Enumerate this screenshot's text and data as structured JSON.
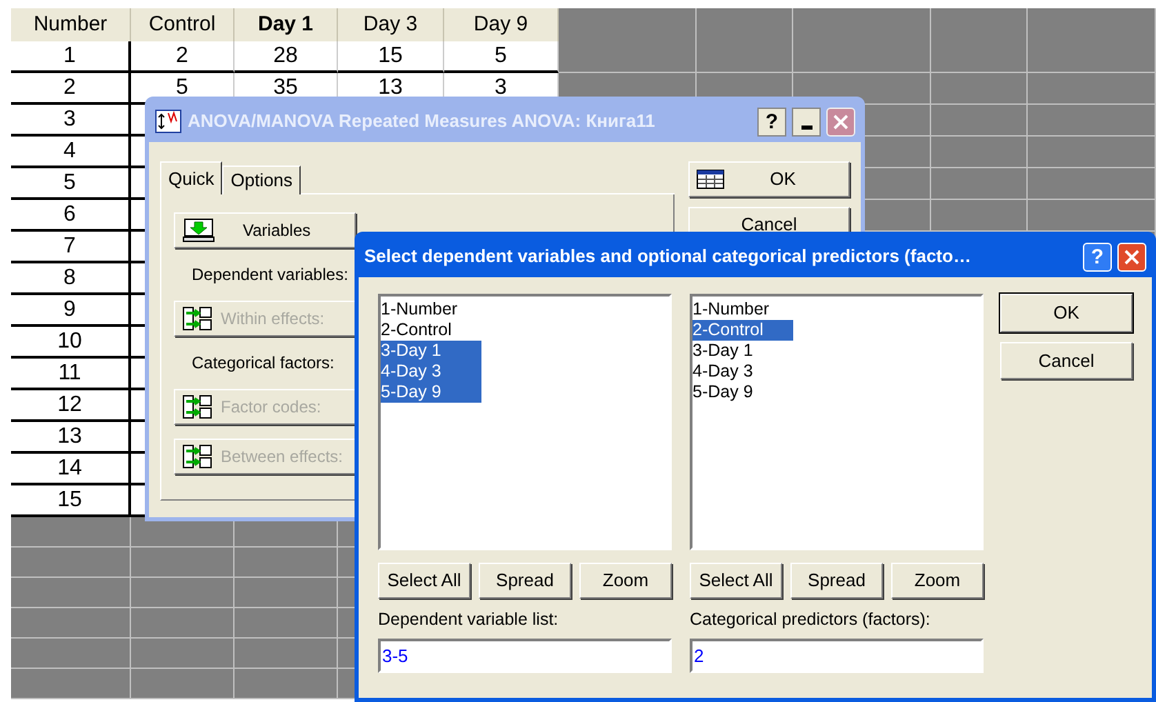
{
  "spreadsheet": {
    "columns": [
      {
        "label": "Number",
        "bold": false
      },
      {
        "label": "Control",
        "bold": false
      },
      {
        "label": "Day 1",
        "bold": true
      },
      {
        "label": "Day 3",
        "bold": false
      },
      {
        "label": "Day 9",
        "bold": false
      }
    ],
    "rows": [
      [
        "1",
        "2",
        "28",
        "15",
        "5"
      ],
      [
        "2",
        "5",
        "35",
        "13",
        "3"
      ],
      [
        "3"
      ],
      [
        "4"
      ],
      [
        "5"
      ],
      [
        "6"
      ],
      [
        "7"
      ],
      [
        "8"
      ],
      [
        "9"
      ],
      [
        "10"
      ],
      [
        "11"
      ],
      [
        "12"
      ],
      [
        "13"
      ],
      [
        "14"
      ],
      [
        "15"
      ]
    ]
  },
  "main_dialog": {
    "title": "ANOVA/MANOVA Repeated Measures ANOVA: Книга11",
    "active": false,
    "help": "?",
    "tabs": [
      {
        "label": "Quick",
        "selected": true
      },
      {
        "label": "Options",
        "selected": false
      }
    ],
    "controls": [
      {
        "kind": "variables",
        "label": "Variables",
        "disabled": false
      },
      {
        "kind": "label",
        "label": "Dependent variables:"
      },
      {
        "kind": "effects",
        "label": "Within effects:",
        "disabled": true
      },
      {
        "kind": "label",
        "label": "Categorical factors:"
      },
      {
        "kind": "effects",
        "label": "Factor codes:",
        "disabled": true
      },
      {
        "kind": "effects",
        "label": "Between effects:",
        "disabled": true
      }
    ],
    "ok": "OK",
    "cancel": "Cancel"
  },
  "select_dialog": {
    "title": "Select dependent variables and optional categorical predictors (facto…",
    "active": true,
    "help": "?",
    "panels": [
      {
        "items": [
          {
            "label": "1-Number",
            "selected": false
          },
          {
            "label": "2-Control",
            "selected": false
          },
          {
            "label": "3-Day 1",
            "selected": true
          },
          {
            "label": "4-Day 3",
            "selected": true
          },
          {
            "label": "5-Day 9",
            "selected": true
          }
        ],
        "buttons": [
          "Select All",
          "Spread",
          "Zoom"
        ],
        "field_label": "Dependent variable list:",
        "value": "3-5"
      },
      {
        "items": [
          {
            "label": "1-Number",
            "selected": false
          },
          {
            "label": "2-Control",
            "selected": true
          },
          {
            "label": "3-Day 1",
            "selected": false
          },
          {
            "label": "4-Day 3",
            "selected": false
          },
          {
            "label": "5-Day 9",
            "selected": false
          }
        ],
        "buttons": [
          "Select All",
          "Spread",
          "Zoom"
        ],
        "field_label": "Categorical predictors (factors):",
        "value": "2"
      }
    ],
    "ok": "OK",
    "cancel": "Cancel"
  }
}
